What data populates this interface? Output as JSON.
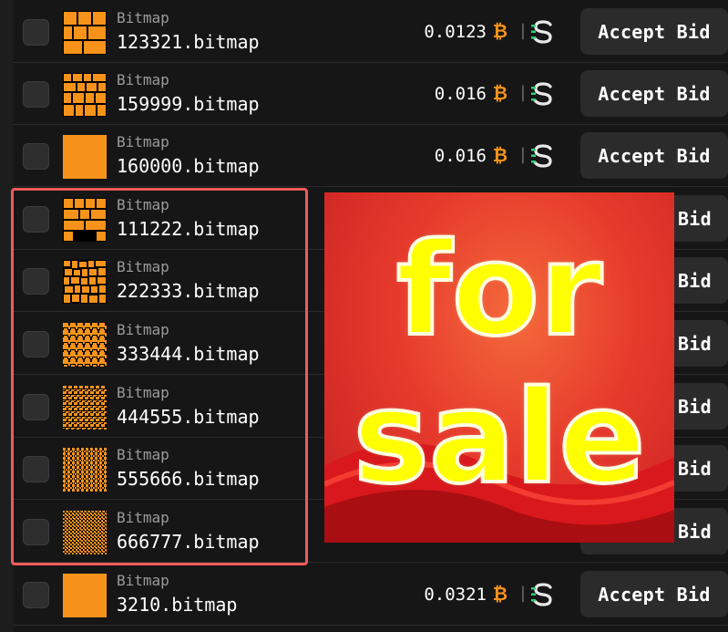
{
  "rows": [
    {
      "category": "Bitmap",
      "name": "123321.bitmap",
      "price": "0.0123",
      "action": "Accept Bid"
    },
    {
      "category": "Bitmap",
      "name": "159999.bitmap",
      "price": "0.016",
      "action": "Accept Bid"
    },
    {
      "category": "Bitmap",
      "name": "160000.bitmap",
      "price": "0.016",
      "action": "Accept Bid"
    },
    {
      "category": "Bitmap",
      "name": "111222.bitmap",
      "price": "",
      "action": "Bid"
    },
    {
      "category": "Bitmap",
      "name": "222333.bitmap",
      "price": "",
      "action": "Bid"
    },
    {
      "category": "Bitmap",
      "name": "333444.bitmap",
      "price": "",
      "action": "Bid"
    },
    {
      "category": "Bitmap",
      "name": "444555.bitmap",
      "price": "",
      "action": "Bid"
    },
    {
      "category": "Bitmap",
      "name": "555666.bitmap",
      "price": "",
      "action": "Bid"
    },
    {
      "category": "Bitmap",
      "name": "666777.bitmap",
      "price": "",
      "action": "Bid"
    },
    {
      "category": "Bitmap",
      "name": "3210.bitmap",
      "price": "0.0321",
      "action": "Accept Bid"
    }
  ],
  "symbols": {
    "currency": "₿",
    "separator": "|",
    "marketplace_icon": "s-marketplace-icon"
  },
  "poster": {
    "line1": "for",
    "line2": "sale"
  },
  "colors": {
    "accent": "#f7931a",
    "highlight": "#f05a5a",
    "text_yellow": "#ffff00",
    "poster_red": "#e63a2c"
  }
}
